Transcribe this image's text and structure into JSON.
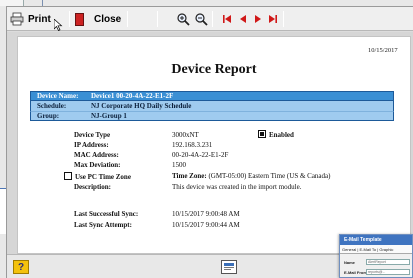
{
  "toolbar": {
    "print_label": "Print",
    "close_label": "Close",
    "icons": [
      "printer-icon",
      "close-door-icon",
      "zoom-in-icon",
      "zoom-out-icon",
      "first-page-icon",
      "prev-page-icon",
      "next-page-icon",
      "last-page-icon"
    ]
  },
  "report": {
    "date": "10/15/2017",
    "title": "Device Report",
    "bands": {
      "device_name_label": "Device Name:",
      "device_name_value": "Device1 00-20-4A-22-E1-2F",
      "schedule_label": "Schedule:",
      "schedule_value": "NJ Corporate HQ Daily Schedule",
      "group_label": "Group:",
      "group_value": "NJ-Group 1"
    },
    "fields": {
      "device_type_label": "Device Type",
      "device_type_value": "3000xNT",
      "enabled_label": "Enabled",
      "ip_label": "IP Address:",
      "ip_value": "192.168.3.231",
      "mac_label": "MAC Address:",
      "mac_value": "00-20-4A-22-E1-2F",
      "max_dev_label": "Max Deviation:",
      "max_dev_value": "1500",
      "use_pc_tz_label": "Use PC Time Zone",
      "time_zone_label": "Time Zone:",
      "time_zone_value": "(GMT-05:00) Eastern Time (US & Canada)",
      "description_label": "Description:",
      "description_value": "This device was created in the import module.",
      "last_sync_label": "Last Successful Sync:",
      "last_sync_value": "10/15/2017 9:00:48 AM",
      "last_attempt_label": "Last Sync Attempt:",
      "last_attempt_value": "10/15/2017 9:00:44 AM"
    }
  },
  "statusbar": {
    "help_label": "?"
  },
  "email_window": {
    "title": "E-Mail Template",
    "tabs": "General | E-Mail To | Graphic",
    "name_label": "Name",
    "name_value": "AlertReport",
    "email_from_label": "E-Mail From",
    "email_from_value": "reports@..."
  },
  "colors": {
    "band_dark": "#3a8fd4",
    "band_light": "#9fcbef",
    "close_red": "#cc2222",
    "nav_red": "#d01818",
    "help_yellow": "#f4c20d"
  }
}
